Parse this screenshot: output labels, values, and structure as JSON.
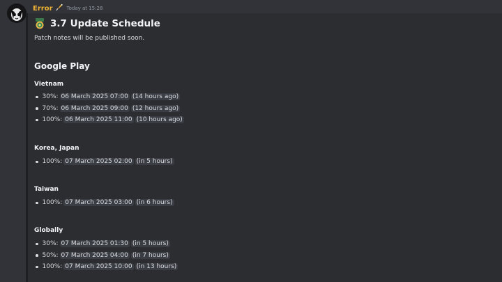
{
  "message": {
    "username": "Error",
    "timestamp": "Today at 15:28"
  },
  "embed": {
    "title": "3.7 Update Schedule",
    "description": "Patch notes will be published soon.",
    "section_heading": "Google Play",
    "groups": [
      {
        "heading": "Vietnam",
        "items": [
          {
            "percent": "30%:",
            "date": "06 March 2025 07:00",
            "relative": "(14 hours ago)"
          },
          {
            "percent": "70%:",
            "date": "06 March 2025 09:00",
            "relative": "(12 hours ago)"
          },
          {
            "percent": "100%:",
            "date": "06 March 2025 11:00",
            "relative": "(10 hours ago)"
          }
        ]
      },
      {
        "heading": "Korea, Japan",
        "items": [
          {
            "percent": "100%:",
            "date": "07 March 2025 02:00",
            "relative": "(in 5 hours)"
          }
        ]
      },
      {
        "heading": "Taiwan",
        "items": [
          {
            "percent": "100%:",
            "date": "07 March 2025 03:00",
            "relative": "(in 6 hours)"
          }
        ]
      },
      {
        "heading": "Globally",
        "items": [
          {
            "percent": "30%:",
            "date": "07 March 2025 01:30",
            "relative": "(in 5 hours)"
          },
          {
            "percent": "50%:",
            "date": "07 March 2025 04:00",
            "relative": "(in 7 hours)"
          },
          {
            "percent": "100%:",
            "date": "07 March 2025 10:00",
            "relative": "(in 13 hours)"
          }
        ]
      }
    ]
  },
  "colors": {
    "background": "#313338",
    "embed_background": "#2b2d31",
    "username": "#f0b232",
    "timestamp_chip": "#3b3d44"
  },
  "icons": {
    "avatar": "user-avatar",
    "role": "sparkle-role-icon",
    "title_emoji": "medal-emoji-icon"
  }
}
